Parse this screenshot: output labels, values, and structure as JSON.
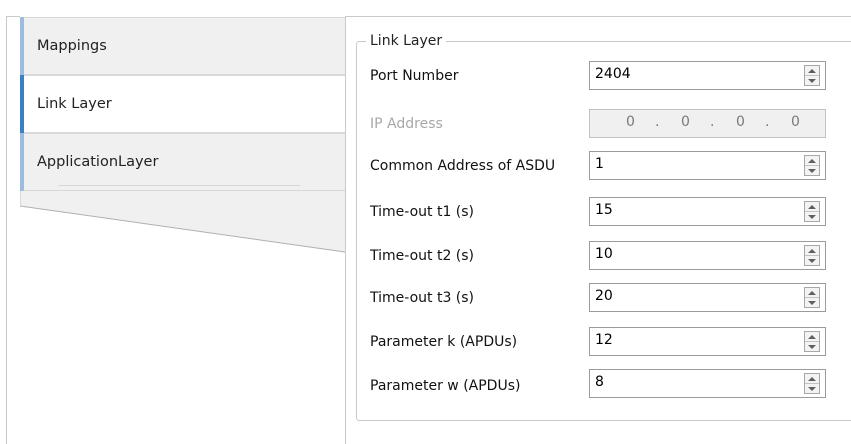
{
  "tabs": [
    {
      "label": "Mappings",
      "active": false
    },
    {
      "label": "Link Layer",
      "active": true
    },
    {
      "label": "ApplicationLayer",
      "active": false
    }
  ],
  "group": {
    "title": "Link Layer",
    "fields": [
      {
        "label": "Port Number",
        "value": "2404"
      },
      {
        "label": "IP Address",
        "octets": [
          "0",
          "0",
          "0",
          "0"
        ],
        "disabled": true
      },
      {
        "label": "Common Address of ASDU",
        "value": "1"
      },
      {
        "label": "Time-out t1 (s)",
        "value": "15"
      },
      {
        "label": "Time-out t2 (s)",
        "value": "10"
      },
      {
        "label": "Time-out t3 (s)",
        "value": "20"
      },
      {
        "label": "Parameter k (APDUs)",
        "value": "12"
      },
      {
        "label": "Parameter w (APDUs)",
        "value": "8"
      }
    ]
  },
  "colors": {
    "active_tab_accent": "#3c7fc6",
    "inactive_tab_accent": "#9ebcdd"
  },
  "icons": {
    "spin_up": "spin-up-arrow-icon",
    "spin_down": "spin-down-arrow-icon"
  }
}
